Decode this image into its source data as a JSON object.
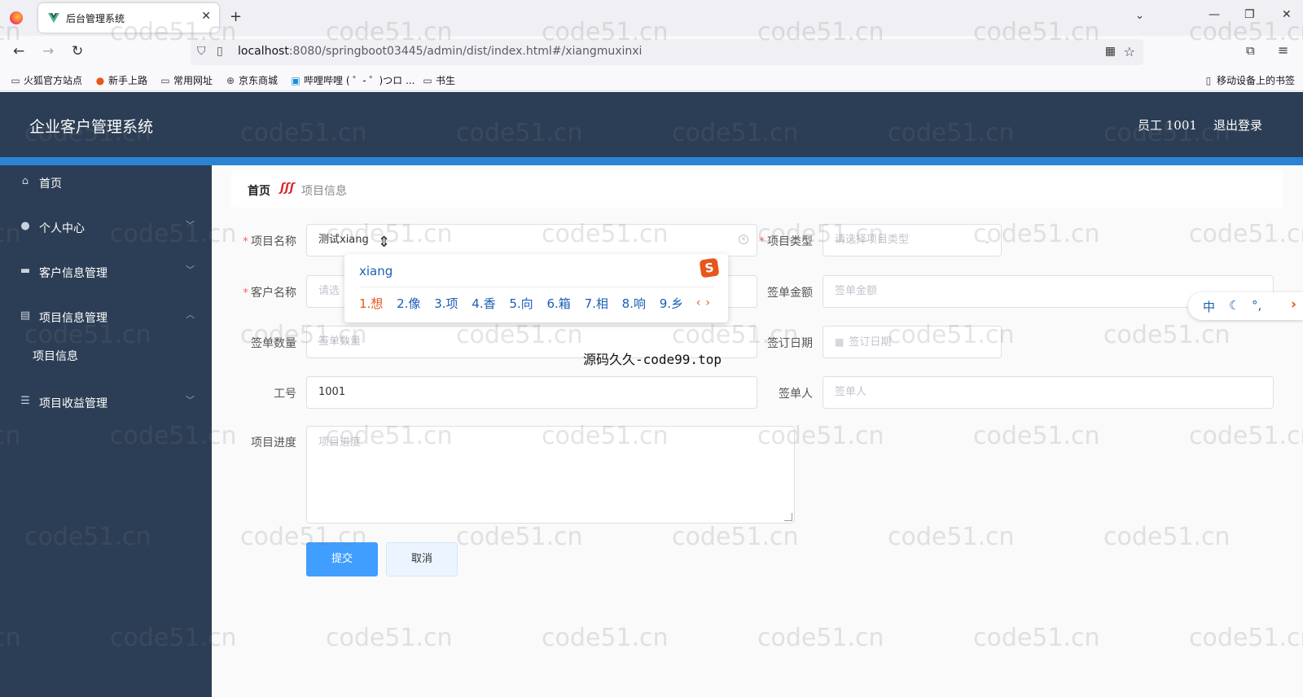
{
  "browser": {
    "tab_title": "后台管理系统",
    "url_host": "localhost",
    "url_path": ":8080/springboot03445/admin/dist/index.html#/xiangmuxinxi",
    "bookmarks": [
      "火狐官方站点",
      "新手上路",
      "常用网址",
      "京东商城",
      "哔哩哔哩 ( ゜- ゜)つロ ...",
      "书生"
    ],
    "mobile_bookmarks": "移动设备上的书签"
  },
  "header": {
    "brand": "企业客户管理系统",
    "user": "员工 1001",
    "logout": "退出登录"
  },
  "sidebar": {
    "items": [
      {
        "label": "首页",
        "icon": "home-icon"
      },
      {
        "label": "个人中心",
        "icon": "user-icon"
      },
      {
        "label": "客户信息管理",
        "icon": "briefcase-icon"
      },
      {
        "label": "项目信息管理",
        "icon": "clipboard-icon"
      },
      {
        "label": "项目收益管理",
        "icon": "list-icon"
      }
    ],
    "sub_item": "项目信息"
  },
  "breadcrumb": {
    "home": "首页",
    "current": "项目信息"
  },
  "form": {
    "project_name_label": "项目名称",
    "project_name_value": "测试xiang",
    "project_type_label": "项目类型",
    "project_type_placeholder": "请选择项目类型",
    "customer_name_label": "客户名称",
    "customer_name_placeholder": "请选",
    "contract_amount_label": "签单金额",
    "contract_amount_placeholder": "签单金额",
    "contract_count_label": "签单数量",
    "contract_count_placeholder": "签单数量",
    "sign_date_label": "签订日期",
    "sign_date_placeholder": "签订日期",
    "employee_no_label": "工号",
    "employee_no_value": "1001",
    "signer_label": "签单人",
    "signer_placeholder": "签单人",
    "progress_label": "项目进度",
    "progress_placeholder": "项目进度",
    "submit": "提交",
    "cancel": "取消"
  },
  "ime": {
    "composition": "xiang",
    "candidates": [
      "1.想",
      "2.像",
      "3.项",
      "4.香",
      "5.向",
      "6.箱",
      "7.相",
      "8.响",
      "9.乡"
    ],
    "status_lang": "中"
  },
  "watermark": {
    "text": "code51.cn",
    "center": "源码久久-code99.top"
  },
  "colors": {
    "header_bg": "#2c3e55",
    "accent": "#2b84d3",
    "primary": "#409eff",
    "required": "#f56c6c"
  }
}
